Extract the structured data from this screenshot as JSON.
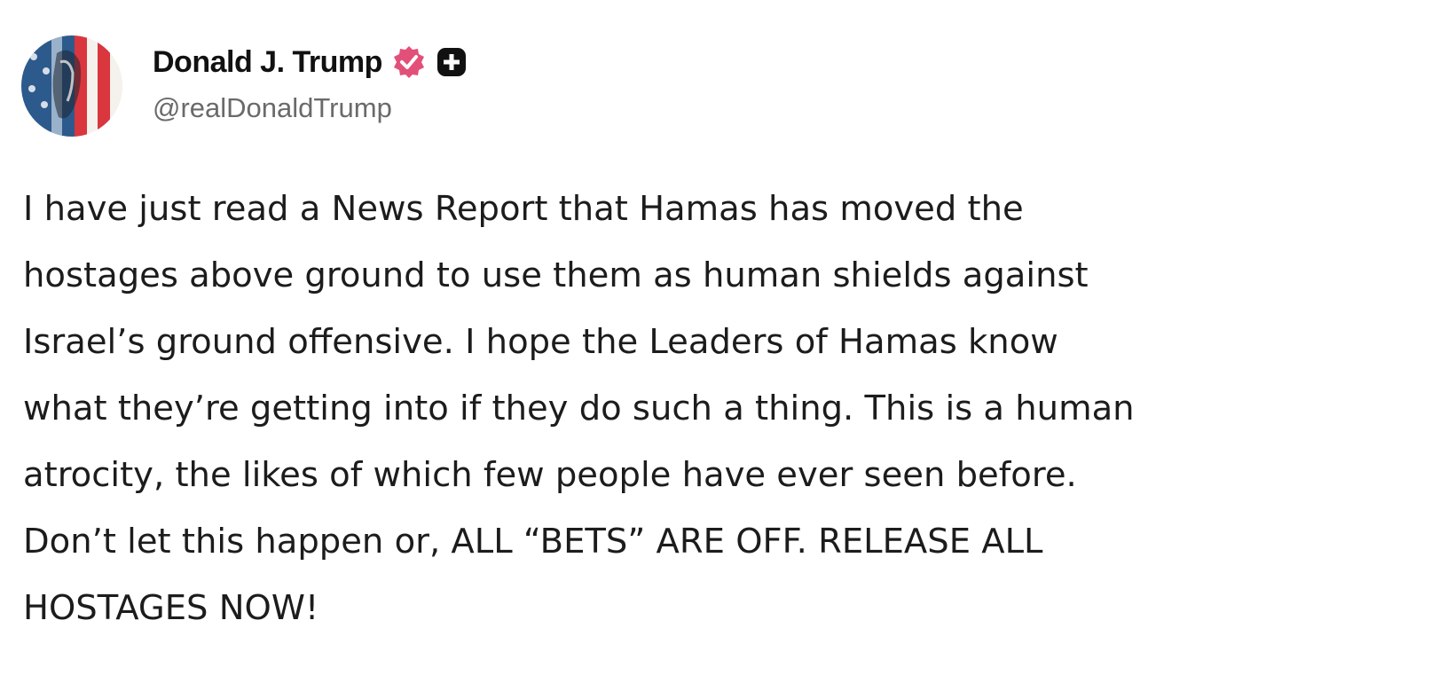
{
  "post": {
    "author": {
      "display_name": "Donald J. Trump",
      "handle": "@realDonaldTrump",
      "verified": true
    },
    "icons": {
      "verified": "verified-check-icon",
      "badge": "plus-badge-icon"
    },
    "text_lines": [
      "I have just read a News Report that Hamas has moved the",
      "hostages above ground to use them as human shields against",
      "Israel’s ground offensive. I hope the Leaders of Hamas know",
      "what they’re getting into if they do such a thing. This is a human",
      "atrocity, the likes of which few people have ever seen before.",
      "Don’t let this happen or, ALL “BETS” ARE OFF. RELEASE ALL",
      "HOSTAGES NOW!"
    ]
  },
  "colors": {
    "verified_badge": "#e2507a",
    "plus_badge": "#111111",
    "handle_text": "#6a6a6a",
    "body_text": "#1c1c1c"
  }
}
